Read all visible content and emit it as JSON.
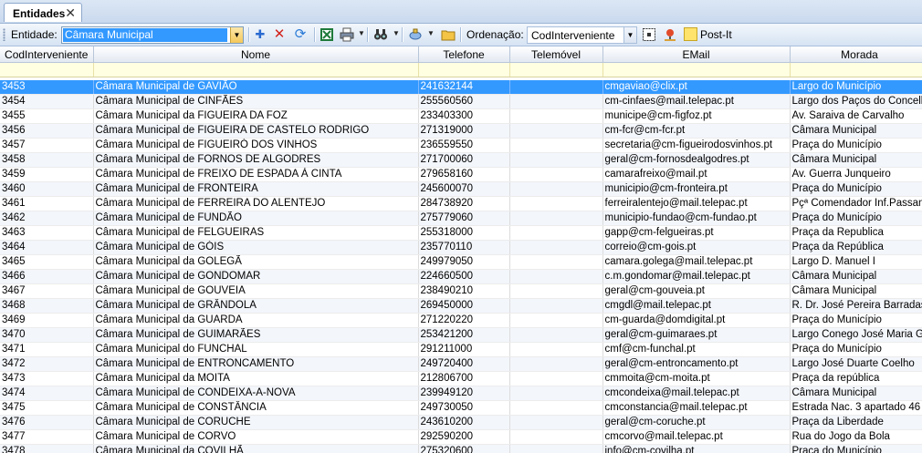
{
  "tab": {
    "title": "Entidades",
    "close": "✕"
  },
  "toolbar": {
    "entity_label": "Entidade:",
    "entity_value": "Câmara Municipal",
    "order_label": "Ordenação:",
    "order_value": "CodInterveniente",
    "postit_label": "Post-It"
  },
  "columns": [
    "CodInterveniente",
    "Nome",
    "Telefone",
    "Telemóvel",
    "EMail",
    "Morada"
  ],
  "rows": [
    [
      "3453",
      "Câmara Municipal de GAVIÃO",
      "241632144",
      "",
      "cmgaviao@clix.pt",
      "Largo do Município"
    ],
    [
      "3454",
      "Câmara Municipal de CINFÃES",
      "255560560",
      "",
      "cm-cinfaes@mail.telepac.pt",
      "Largo dos Paços do Concelho"
    ],
    [
      "3455",
      "Câmara Municipal da FIGUEIRA DA FOZ",
      "233403300",
      "",
      "municipe@cm-figfoz.pt",
      "Av. Saraiva de Carvalho"
    ],
    [
      "3456",
      "Câmara Municipal de FIGUEIRA DE CASTELO RODRIGO",
      "271319000",
      "",
      "cm-fcr@cm-fcr.pt",
      "Câmara Municipal"
    ],
    [
      "3457",
      "Câmara Municipal de FIGUEIRÓ DOS VINHOS",
      "236559550",
      "",
      "secretaria@cm-figueirodosvinhos.pt",
      "Praça do Município"
    ],
    [
      "3458",
      "Câmara Municipal de FORNOS DE ALGODRES",
      "271700060",
      "",
      "geral@cm-fornosdealgodres.pt",
      "Câmara Municipal"
    ],
    [
      "3459",
      "Câmara Municipal de FREIXO DE ESPADA À CINTA",
      "279658160",
      "",
      "camarafreixo@mail.pt",
      "Av. Guerra Junqueiro"
    ],
    [
      "3460",
      "Câmara Municipal de FRONTEIRA",
      "245600070",
      "",
      "municipio@cm-fronteira.pt",
      "Praça do Município"
    ],
    [
      "3461",
      "Câmara Municipal de FERREIRA DO ALENTEJO",
      "284738920",
      "",
      "ferreiralentejo@mail.telepac.pt",
      "Pçª Comendador Inf.Passanha"
    ],
    [
      "3462",
      "Câmara Municipal de FUNDÃO",
      "275779060",
      "",
      "municipio-fundao@cm-fundao.pt",
      "Praça do Município"
    ],
    [
      "3463",
      "Câmara Municipal de FELGUEIRAS",
      "255318000",
      "",
      "gapp@cm-felgueiras.pt",
      "Praça da Republica"
    ],
    [
      "3464",
      "Câmara Municipal de GÓIS",
      "235770110",
      "",
      "correio@cm-gois.pt",
      "Praça da República"
    ],
    [
      "3465",
      "Câmara Municipal da GOLEGÃ",
      "249979050",
      "",
      "camara.golega@mail.telepac.pt",
      "Largo D. Manuel I"
    ],
    [
      "3466",
      "Câmara Municipal de GONDOMAR",
      "224660500",
      "",
      "c.m.gondomar@mail.telepac.pt",
      "Câmara Municipal"
    ],
    [
      "3467",
      "Câmara Municipal de GOUVEIA",
      "238490210",
      "",
      "geral@cm-gouveia.pt",
      "Câmara Municipal"
    ],
    [
      "3468",
      "Câmara Municipal de GRÂNDOLA",
      "269450000",
      "",
      "cmgdl@mail.telepac.pt",
      "R. Dr. José Pereira Barradas"
    ],
    [
      "3469",
      "Câmara Municipal da GUARDA",
      "271220220",
      "",
      "cm-guarda@domdigital.pt",
      "Praça do Município"
    ],
    [
      "3470",
      "Câmara Municipal de GUIMARÃES",
      "253421200",
      "",
      "geral@cm-guimaraes.pt",
      "Largo Conego José Maria Gomes"
    ],
    [
      "3471",
      "Câmara Municipal do FUNCHAL",
      "291211000",
      "",
      "cmf@cm-funchal.pt",
      "Praça do Município"
    ],
    [
      "3472",
      "Câmara Municipal de ENTRONCAMENTO",
      "249720400",
      "",
      "geral@cm-entroncamento.pt",
      "Largo José Duarte Coelho"
    ],
    [
      "3473",
      "Câmara Municipal da MOITA",
      "212806700",
      "",
      "cmmoita@cm-moita.pt",
      "Praça da república"
    ],
    [
      "3474",
      "Câmara Municipal de CONDEIXA-A-NOVA",
      "239949120",
      "",
      "cmcondeixa@mail.telepac.pt",
      "Câmara Municipal"
    ],
    [
      "3475",
      "Câmara Municipal de CONSTÂNCIA",
      "249730050",
      "",
      "cmconstancia@mail.telepac.pt",
      "Estrada Nac. 3 apartado 46"
    ],
    [
      "3476",
      "Câmara Municipal de CORUCHE",
      "243610200",
      "",
      "geral@cm-coruche.pt",
      "Praça da Liberdade"
    ],
    [
      "3477",
      "Câmara Municipal de CORVO",
      "292590200",
      "",
      "cmcorvo@mail.telepac.pt",
      "Rua do Jogo da Bola"
    ],
    [
      "3478",
      "Câmara Municipal da COVILHÃ",
      "275320600",
      "",
      "info@cm-covilha.pt",
      "Praça do Município"
    ]
  ],
  "selected_row": "3453",
  "colors": {
    "selection": "#3399ff",
    "filter_row": "#ffffe1",
    "toolbar": "#d6e3f3"
  },
  "icons": [
    "add-icon",
    "delete-icon",
    "refresh-icon",
    "excel-icon",
    "print-icon",
    "binoculars-icon",
    "filter-icon",
    "folder-icon",
    "grid-icon",
    "map-pin-icon",
    "postit-icon"
  ]
}
